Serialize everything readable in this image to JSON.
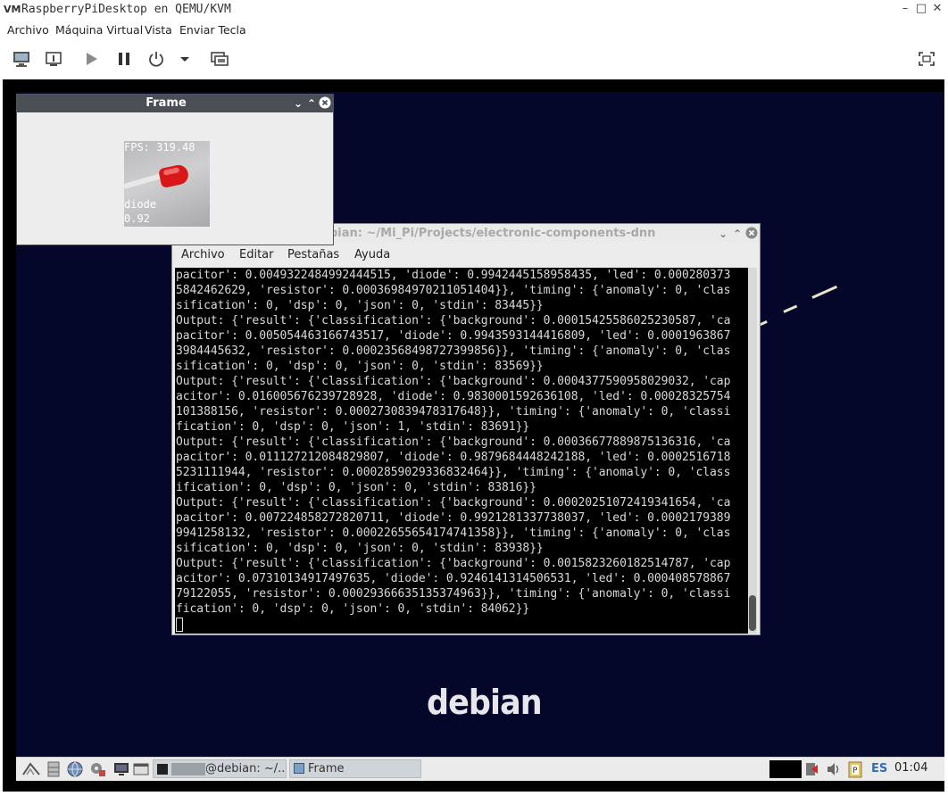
{
  "host": {
    "title": "RaspberryPiDesktop en QEMU/KVM",
    "logo_text": "VM",
    "window_controls": [
      "–",
      "□",
      "✕"
    ],
    "menu": [
      "Archivo",
      "Máquina Virtual",
      "Vista",
      "Enviar Tecla"
    ],
    "toolbar_icons": [
      "monitor-icon",
      "details-icon",
      "play-icon",
      "pause-icon",
      "power-icon",
      "dropdown-icon",
      "snapshot-icon",
      "fullscreen-icon"
    ]
  },
  "frame_window": {
    "title": "Frame",
    "fps": "FPS: 319.48",
    "label": "diode",
    "score": "0.92"
  },
  "terminal": {
    "title": "bian: ~/Mi_Pi/Projects/electronic-components-dnn",
    "menu": [
      "Archivo",
      "Editar",
      "Pestañas",
      "Ayuda"
    ],
    "output": "pacitor': 0.0049322484992444515, 'diode': 0.9942445158958435, 'led': 0.000280373\n5842462629, 'resistor': 0.00036984970211051404}}, 'timing': {'anomaly': 0, 'clas\nsification': 0, 'dsp': 0, 'json': 0, 'stdin': 83445}}\nOutput: {'result': {'classification': {'background': 0.00015425586025230587, 'ca\npacitor': 0.005054463166743517, 'diode': 0.9943593144416809, 'led': 0.0001963867\n3984445632, 'resistor': 0.00023568498727399856}}, 'timing': {'anomaly': 0, 'clas\nsification': 0, 'dsp': 0, 'json': 0, 'stdin': 83569}}\nOutput: {'result': {'classification': {'background': 0.0004377590958029032, 'cap\nacitor': 0.016005676239728928, 'diode': 0.9830001592636108, 'led': 0.00028325754\n101388156, 'resistor': 0.0002730839478317648}}, 'timing': {'anomaly': 0, 'classi\nfication': 0, 'dsp': 0, 'json': 1, 'stdin': 83691}}\nOutput: {'result': {'classification': {'background': 0.00036677889875136316, 'ca\npacitor': 0.011127212084829807, 'diode': 0.9879684448242188, 'led': 0.0002516718\n5231111944, 'resistor': 0.0002859029336832464}}, 'timing': {'anomaly': 0, 'class\nification': 0, 'dsp': 0, 'json': 0, 'stdin': 83816}}\nOutput: {'result': {'classification': {'background': 0.00020251072419341654, 'ca\npacitor': 0.007224858272820711, 'diode': 0.9921281337738037, 'led': 0.0002179389\n9941258132, 'resistor': 0.00022655654174741358}}, 'timing': {'anomaly': 0, 'clas\nsification': 0, 'dsp': 0, 'json': 0, 'stdin': 83938}}\nOutput: {'result': {'classification': {'background': 0.0015823260182514787, 'cap\nacitor': 0.07310134917497635, 'diode': 0.9246141314506531, 'led': 0.000408578867\n79122055, 'resistor': 0.00029366635135374963}}, 'timing': {'anomaly': 0, 'classi\nfication': 0, 'dsp': 0, 'json': 0, 'stdin': 84062}}"
  },
  "desktop": {
    "wallpaper_text": "debian"
  },
  "taskbar": {
    "tasks": [
      "@debian: ~/...",
      "Frame"
    ],
    "keyboard_layout": "ES",
    "clock": "01:04"
  },
  "colors": {
    "desktop_bg": "#05072a",
    "frame_titlebar": "#4a4f55",
    "terminal_bg": "#000000",
    "keyboard_layout": "#2f6db5"
  }
}
